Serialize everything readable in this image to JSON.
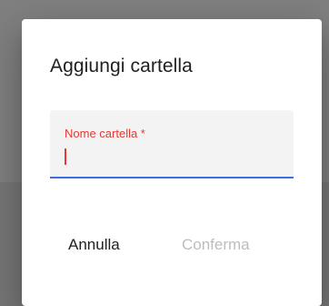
{
  "dialog": {
    "title": "Aggiungi cartella",
    "field": {
      "label": "Nome cartella *",
      "value": "",
      "placeholder": ""
    },
    "actions": {
      "cancel_label": "Annulla",
      "confirm_label": "Conferma",
      "confirm_disabled": true
    }
  },
  "colors": {
    "label_error": "#e53935",
    "field_underline": "#3f6fd6",
    "disabled_text": "#bdbdbd",
    "backdrop": "#7b7b7b"
  }
}
